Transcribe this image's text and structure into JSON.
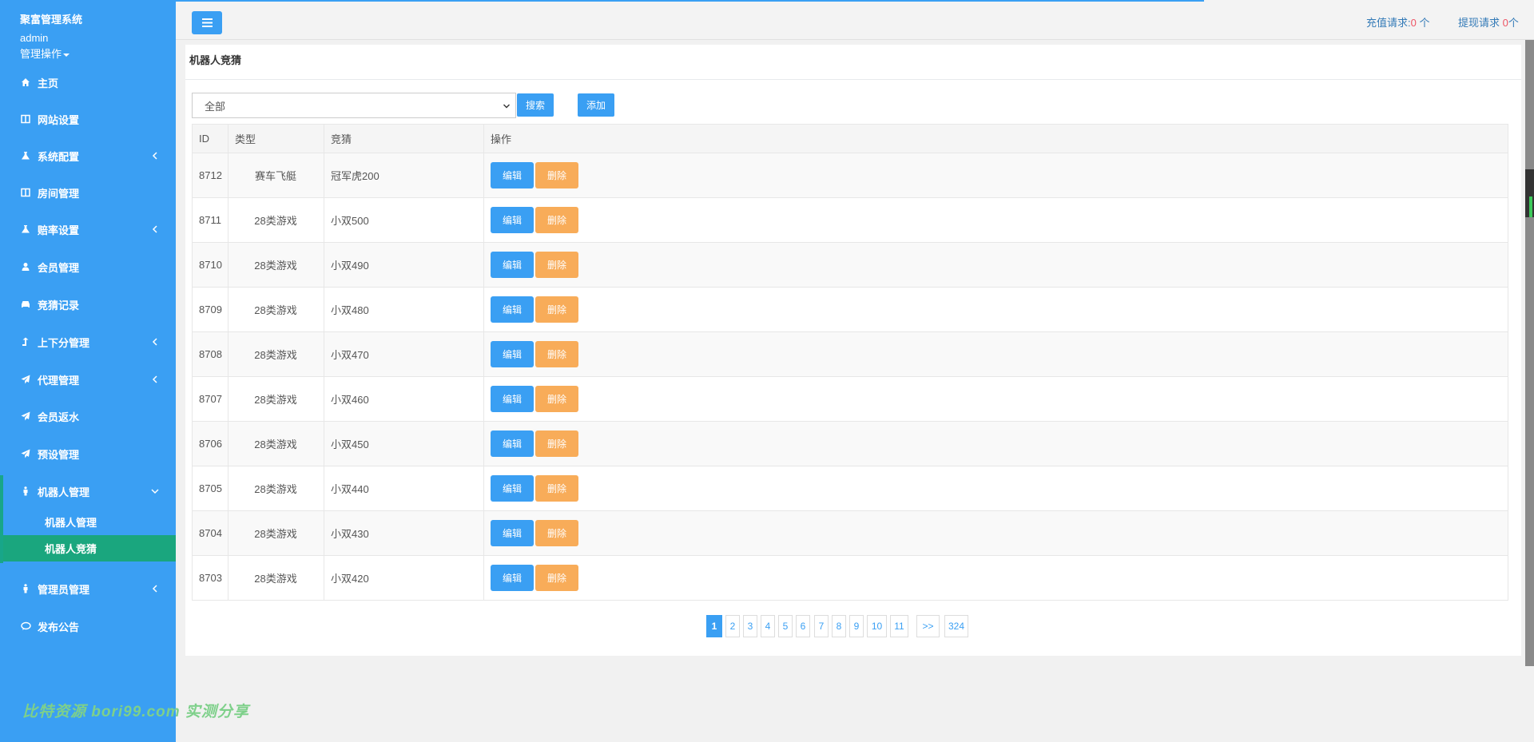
{
  "sidebar": {
    "brand": "聚富管理系统",
    "user": "admin",
    "user_menu": "管理操作",
    "items": [
      {
        "label": "主页"
      },
      {
        "label": "网站设置"
      },
      {
        "label": "系统配置"
      },
      {
        "label": "房间管理"
      },
      {
        "label": "赔率设置"
      },
      {
        "label": "会员管理"
      },
      {
        "label": "竞猜记录"
      },
      {
        "label": "上下分管理"
      },
      {
        "label": "代理管理"
      },
      {
        "label": "会员返水"
      },
      {
        "label": "预设管理"
      },
      {
        "label": "机器人管理"
      },
      {
        "label": "管理员管理"
      },
      {
        "label": "发布公告"
      }
    ],
    "sub_items": [
      {
        "label": "机器人管理"
      },
      {
        "label": "机器人竞猜"
      }
    ]
  },
  "topbar": {
    "recharge_label": "充值请求:",
    "recharge_count": "0",
    "recharge_unit": "个",
    "withdraw_label": "提现请求",
    "withdraw_count": "0",
    "withdraw_unit": "个"
  },
  "panel": {
    "title": "机器人竞猜",
    "filter_value": "全部",
    "search_label": "搜索",
    "add_label": "添加"
  },
  "table": {
    "headers": [
      "ID",
      "类型",
      "竞猜",
      "操作"
    ],
    "edit_label": "编辑",
    "delete_label": "删除",
    "rows": [
      {
        "id": "8712",
        "type": "赛车飞艇",
        "guess": "冠军虎200"
      },
      {
        "id": "8711",
        "type": "28类游戏",
        "guess": "小双500"
      },
      {
        "id": "8710",
        "type": "28类游戏",
        "guess": "小双490"
      },
      {
        "id": "8709",
        "type": "28类游戏",
        "guess": "小双480"
      },
      {
        "id": "8708",
        "type": "28类游戏",
        "guess": "小双470"
      },
      {
        "id": "8707",
        "type": "28类游戏",
        "guess": "小双460"
      },
      {
        "id": "8706",
        "type": "28类游戏",
        "guess": "小双450"
      },
      {
        "id": "8705",
        "type": "28类游戏",
        "guess": "小双440"
      },
      {
        "id": "8704",
        "type": "28类游戏",
        "guess": "小双430"
      },
      {
        "id": "8703",
        "type": "28类游戏",
        "guess": "小双420"
      }
    ]
  },
  "pager": [
    "1",
    "2",
    "3",
    "4",
    "5",
    "6",
    "7",
    "8",
    "9",
    "10",
    "11",
    ">>",
    "324"
  ],
  "watermark": "比特资源 bori99.com 实测分享",
  "colors": {
    "sidebar": "#3a9ff3",
    "active_sub": "#1aa67e",
    "edit": "#3a9ff3",
    "delete": "#f8ac59",
    "count": "#ed5565"
  }
}
